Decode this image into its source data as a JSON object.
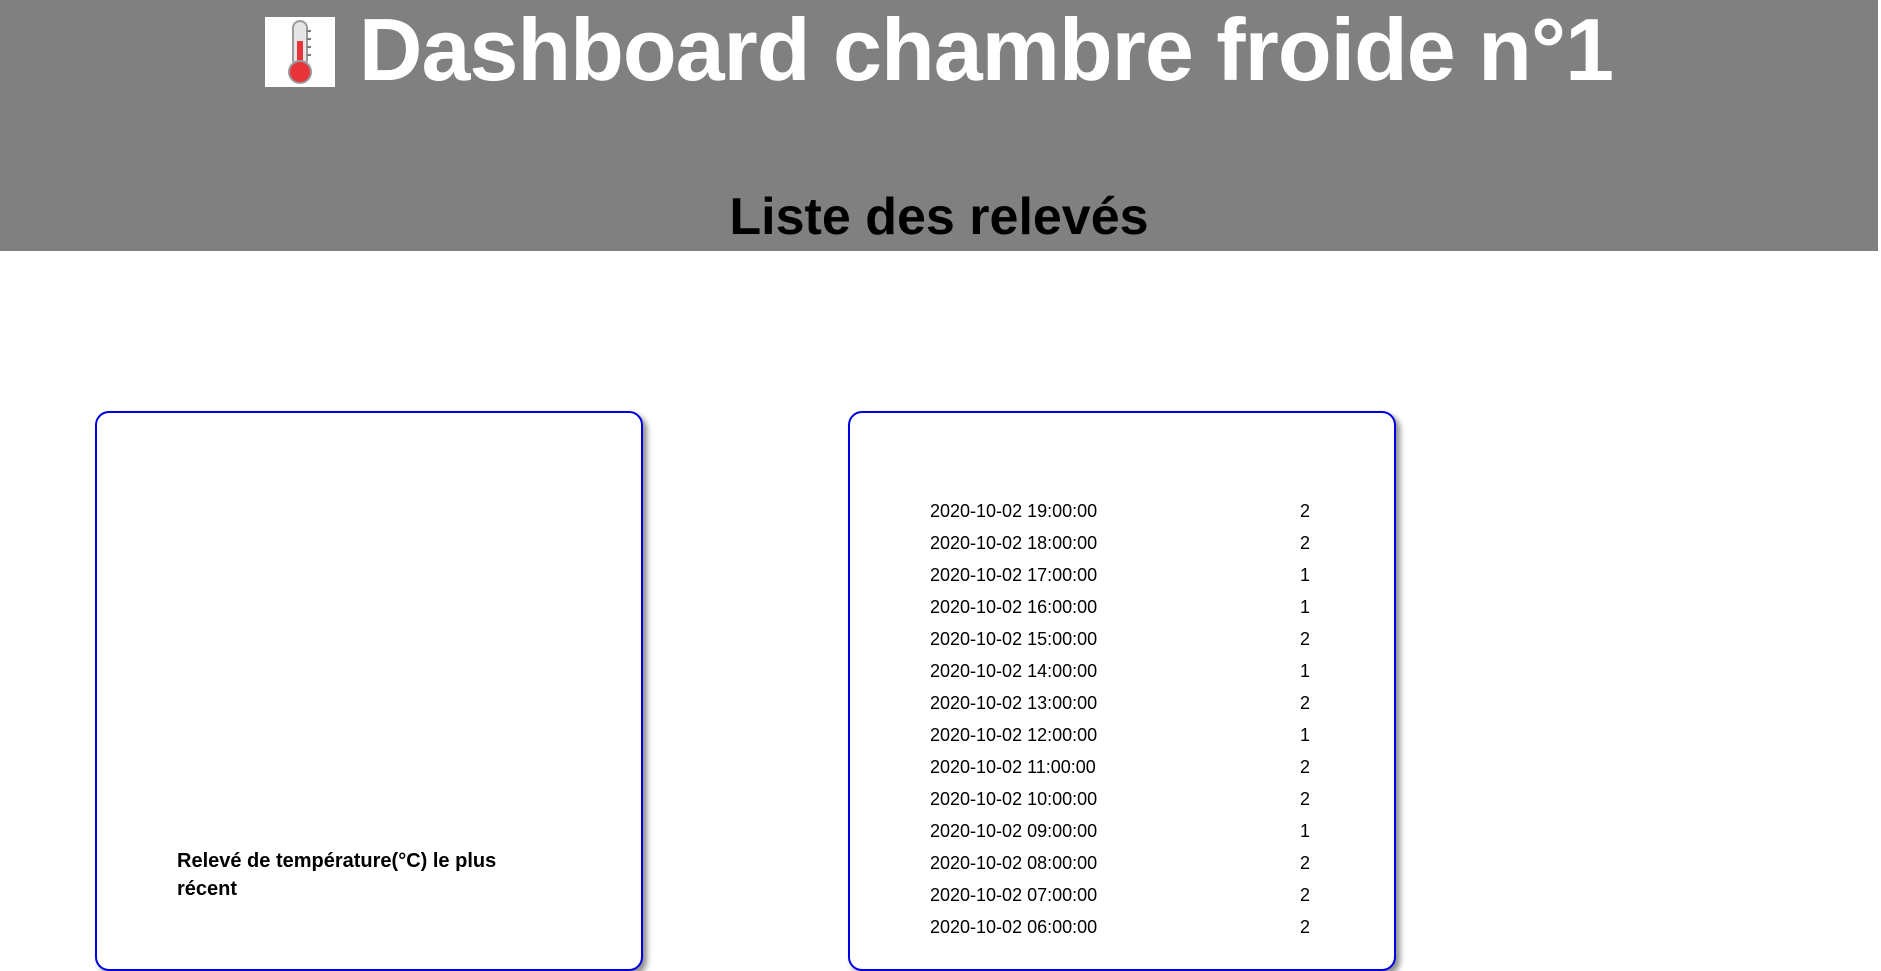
{
  "header": {
    "title": "Dashboard chambre froide n°1",
    "title_icon": "thermometer-icon",
    "subtitle": "Liste des relevés",
    "background_color": "#808080"
  },
  "latest_card": {
    "label": "Relevé de température(°C) le plus récent"
  },
  "readings_card": {
    "rows": [
      {
        "datetime": "2020-10-02 19:00:00",
        "value": "2"
      },
      {
        "datetime": "2020-10-02 18:00:00",
        "value": "2"
      },
      {
        "datetime": "2020-10-02 17:00:00",
        "value": "1"
      },
      {
        "datetime": "2020-10-02 16:00:00",
        "value": "1"
      },
      {
        "datetime": "2020-10-02 15:00:00",
        "value": "2"
      },
      {
        "datetime": "2020-10-02 14:00:00",
        "value": "1"
      },
      {
        "datetime": "2020-10-02 13:00:00",
        "value": "2"
      },
      {
        "datetime": "2020-10-02 12:00:00",
        "value": "1"
      },
      {
        "datetime": "2020-10-02 11:00:00",
        "value": "2"
      },
      {
        "datetime": "2020-10-02 10:00:00",
        "value": "2"
      },
      {
        "datetime": "2020-10-02 09:00:00",
        "value": "1"
      },
      {
        "datetime": "2020-10-02 08:00:00",
        "value": "2"
      },
      {
        "datetime": "2020-10-02 07:00:00",
        "value": "2"
      },
      {
        "datetime": "2020-10-02 06:00:00",
        "value": "2"
      }
    ]
  },
  "colors": {
    "card_border": "#0000e0",
    "header_bg": "#808080"
  }
}
